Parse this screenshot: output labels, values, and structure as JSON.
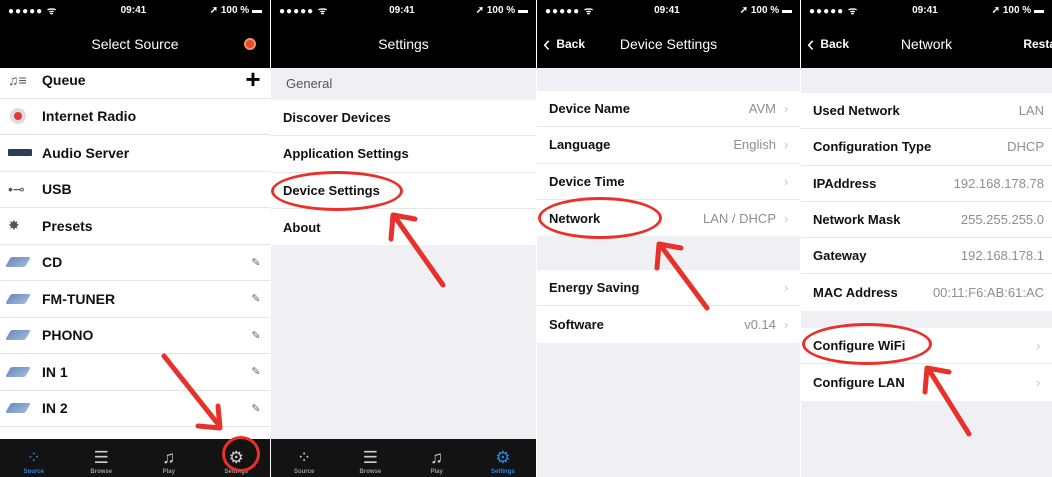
{
  "status": {
    "signal": "●●●●● ",
    "wifi": "ᯤ",
    "time": "09:41",
    "battery": "100 %",
    "arrow": "➚"
  },
  "screen1": {
    "title": "Select Source",
    "items": [
      {
        "icon": "queue-icon",
        "label": "Queue",
        "action": "+"
      },
      {
        "icon": "internet-radio-icon",
        "label": "Internet Radio"
      },
      {
        "icon": "audio-server-icon",
        "label": "Audio Server"
      },
      {
        "icon": "usb-icon",
        "label": "USB"
      },
      {
        "icon": "presets-icon",
        "label": "Presets"
      },
      {
        "icon": "input-icon",
        "label": "CD",
        "edit": "✎"
      },
      {
        "icon": "input-icon",
        "label": "FM-TUNER",
        "edit": "✎"
      },
      {
        "icon": "input-icon",
        "label": "PHONO",
        "edit": "✎"
      },
      {
        "icon": "input-icon",
        "label": "IN 1",
        "edit": "✎"
      },
      {
        "icon": "input-icon",
        "label": "IN 2",
        "edit": "✎"
      }
    ]
  },
  "tabs": [
    {
      "label": "Source",
      "icon": "source-icon"
    },
    {
      "label": "Browse",
      "icon": "browse-icon"
    },
    {
      "label": "Play",
      "icon": "play-icon"
    },
    {
      "label": "Settings",
      "icon": "settings-icon"
    }
  ],
  "screen2": {
    "title": "Settings",
    "section": "General",
    "items": [
      "Discover Devices",
      "Application Settings",
      "Device Settings",
      "About"
    ]
  },
  "screen3": {
    "back": "Back",
    "title": "Device Settings",
    "group1": [
      {
        "label": "Device Name",
        "value": "AVM"
      },
      {
        "label": "Language",
        "value": "English"
      },
      {
        "label": "Device Time",
        "value": ""
      },
      {
        "label": "Network",
        "value": "LAN / DHCP"
      }
    ],
    "group2": [
      {
        "label": "Energy Saving",
        "value": ""
      },
      {
        "label": "Software",
        "value": "v0.14"
      }
    ]
  },
  "screen4": {
    "back": "Back",
    "title": "Network",
    "right": "Resta",
    "group1": [
      {
        "label": "Used Network",
        "value": "LAN"
      },
      {
        "label": "Configuration Type",
        "value": "DHCP"
      },
      {
        "label": "IPAddress",
        "value": "192.168.178.78"
      },
      {
        "label": "Network Mask",
        "value": "255.255.255.0"
      },
      {
        "label": "Gateway",
        "value": "192.168.178.1"
      },
      {
        "label": "MAC Address",
        "value": "00:11:F6:AB:61:AC"
      }
    ],
    "group2": [
      {
        "label": "Configure WiFi"
      },
      {
        "label": "Configure LAN"
      }
    ]
  },
  "colors": {
    "annotation": "#e8312a",
    "active_tab": "#2b86e6",
    "navbar": "#000000"
  }
}
